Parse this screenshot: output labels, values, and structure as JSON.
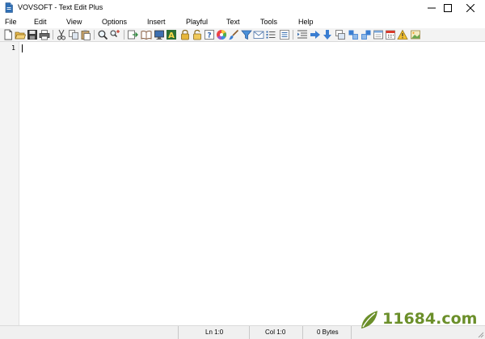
{
  "window": {
    "title": "VOVSOFT - Text Edit Plus",
    "controls": [
      "minimize",
      "maximize",
      "close"
    ]
  },
  "menu": {
    "items": [
      "File",
      "Edit",
      "View",
      "Options",
      "Insert",
      "Playful",
      "Text",
      "Tools",
      "Help"
    ]
  },
  "toolbar": {
    "icons": [
      "new-file",
      "open-folder",
      "save",
      "print",
      "cut",
      "copy",
      "paste",
      "find",
      "replace",
      "go-to-line",
      "book",
      "monitor",
      "font-color",
      "lock",
      "unlock",
      "help",
      "color-wheel",
      "brush",
      "filter",
      "email",
      "list",
      "numbered-list",
      "indent",
      "arrow-right",
      "arrow-down",
      "copy-window",
      "sort-az",
      "sort-za",
      "window",
      "calendar",
      "warning",
      "image"
    ]
  },
  "editor": {
    "line_numbers": [
      "1"
    ],
    "content": ""
  },
  "status": {
    "line": "Ln 1:0",
    "column": "Col 1:0",
    "size": "0 Bytes"
  },
  "watermark": {
    "text": "11684.com",
    "color": "#6b8f2a"
  }
}
